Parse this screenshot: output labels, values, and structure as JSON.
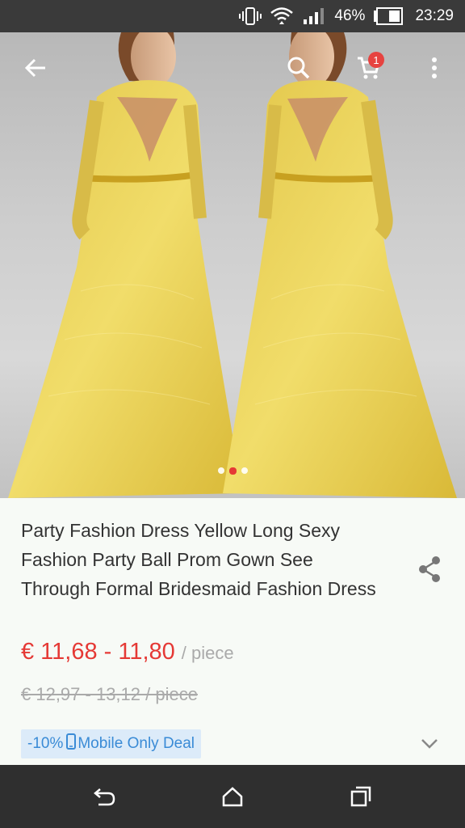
{
  "status_bar": {
    "battery_percent": "46%",
    "time": "23:29",
    "icons": [
      "vibrate-icon",
      "wifi-icon",
      "signal-icon",
      "battery-icon"
    ]
  },
  "header": {
    "back_icon": "arrow-left-icon",
    "search_icon": "search-icon",
    "cart_icon": "cart-icon",
    "cart_count": "1",
    "menu_icon": "more-vert-icon"
  },
  "gallery": {
    "current_index": 2,
    "total": 3
  },
  "product": {
    "title": "Party Fashion Dress Yellow Long Sexy Fashion Party Ball Prom Gown See Through Formal Bridesmaid Fashion Dress",
    "price": "€ 11,68 - 11,80",
    "price_unit": "/ piece",
    "old_price": "€ 12,97 - 13,12 / piece",
    "deal": {
      "discount": "-10%",
      "label": "Mobile Only Deal"
    }
  },
  "colors": {
    "price": "#e53935",
    "badge": "#e64340",
    "deal_bg": "#dcebf9",
    "deal_text": "#3a8bd6"
  },
  "nav_bar": {
    "icons": [
      "back-nav-icon",
      "home-icon",
      "recents-icon"
    ]
  }
}
